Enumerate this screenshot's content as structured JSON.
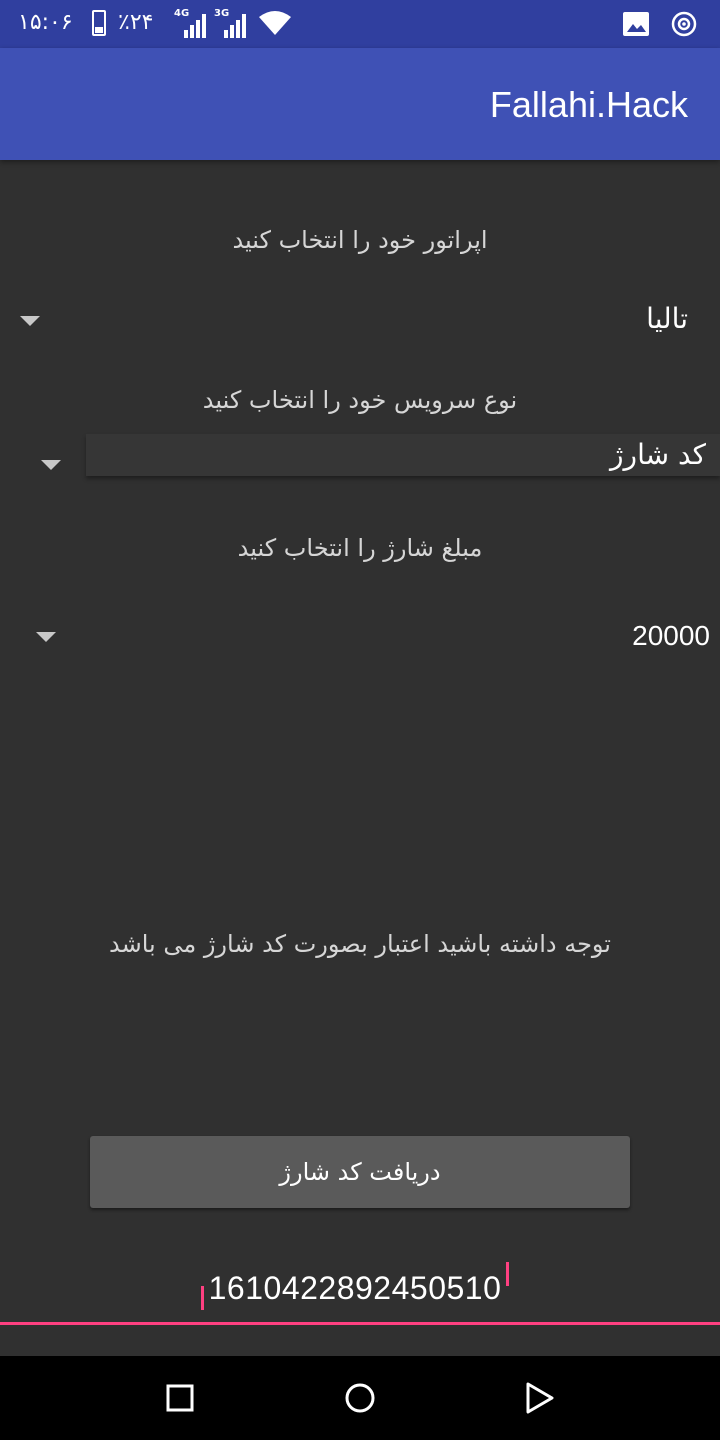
{
  "status_bar": {
    "time": "۱۵:۰۶",
    "battery_percent": "٪۲۴",
    "network_1": "4G",
    "network_2": "3G"
  },
  "app_bar": {
    "title": "Fallahi.Hack"
  },
  "form": {
    "operator_label": "اپراتور خود را انتخاب کنید",
    "operator_value": "تالیا",
    "service_label": "نوع سرویس خود را انتخاب کنید",
    "service_value": "کد شارژ",
    "amount_label": "مبلغ شارژ را انتخاب کنید",
    "amount_value": "20000"
  },
  "note": "توجه داشته باشید اعتبار بصورت کد شارژ می باشد",
  "action_button": "دریافت کد شارژ",
  "charge_code": "1610422892450510",
  "colors": {
    "status_bar": "#303f9f",
    "app_bar": "#3f51b5",
    "background": "#303030",
    "accent": "#ff4081",
    "button": "#5a5a5a"
  },
  "icons": {
    "status": [
      "battery-icon",
      "signal-icon",
      "wifi-icon",
      "image-icon",
      "hotspot-icon"
    ],
    "nav": [
      "recents-icon",
      "home-icon",
      "back-icon"
    ]
  }
}
